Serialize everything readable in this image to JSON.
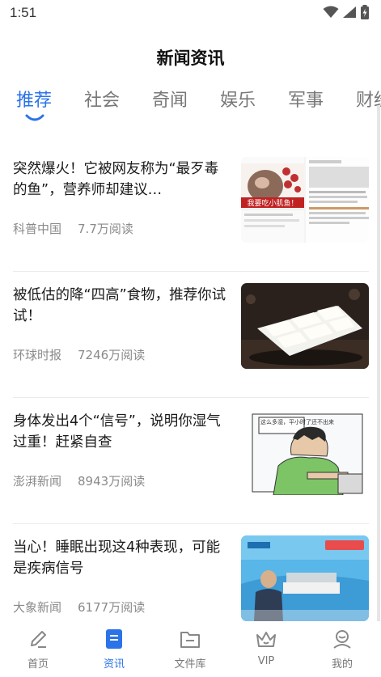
{
  "status_bar": {
    "time": "1:51"
  },
  "header": {
    "title": "新闻资讯"
  },
  "tabs": [
    {
      "label": "推荐",
      "active": true
    },
    {
      "label": "社会",
      "active": false
    },
    {
      "label": "奇闻",
      "active": false
    },
    {
      "label": "娱乐",
      "active": false
    },
    {
      "label": "军事",
      "active": false
    },
    {
      "label": "财经",
      "active": false
    }
  ],
  "news": [
    {
      "headline": "突然爆火！它被网友称为“最歹毒的鱼”，营养师却建议…",
      "source": "科普中国",
      "reads": "7.7万阅读",
      "thumb_caption": "我要吃小肌鱼！"
    },
    {
      "headline": "被低估的降“四高”食物，推荐你试试！",
      "source": "环球时报",
      "reads": "7246万阅读"
    },
    {
      "headline": "身体发出4个“信号”，说明你湿气过重！赶紧自查",
      "source": "澎湃新闻",
      "reads": "8943万阅读",
      "thumb_caption": "这么多湿，平小时了还不出来"
    },
    {
      "headline": "当心！睡眠出现这4种表现，可能是疾病信号",
      "source": "大象新闻",
      "reads": "6177万阅读"
    }
  ],
  "bottom_nav": [
    {
      "label": "首页",
      "icon": "pen-icon"
    },
    {
      "label": "资讯",
      "icon": "news-icon",
      "active": true
    },
    {
      "label": "文件库",
      "icon": "folder-icon"
    },
    {
      "label": "VIP",
      "icon": "crown-icon"
    },
    {
      "label": "我的",
      "icon": "user-icon"
    }
  ],
  "colors": {
    "accent": "#2a73e8",
    "text_muted": "#8a8a8a"
  }
}
